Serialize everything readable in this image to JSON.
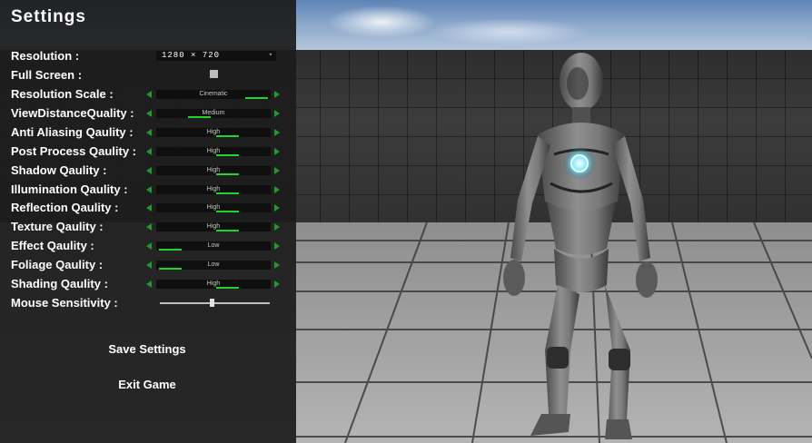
{
  "title": "Settings",
  "resolution": {
    "label": "Resolution :",
    "value": "1280  ×  720"
  },
  "fullscreen": {
    "label": "Full Screen :",
    "checked": false
  },
  "quality_rows": [
    {
      "label": "Resolution Scale :",
      "value": "Cinematic",
      "level": 1.0
    },
    {
      "label": "ViewDistanceQuality :",
      "value": "Medium",
      "level": 0.5
    },
    {
      "label": "Anti Aliasing Qaulity :",
      "value": "High",
      "level": 0.75
    },
    {
      "label": "Post Process Qaulity :",
      "value": "High",
      "level": 0.75
    },
    {
      "label": "Shadow Qaulity :",
      "value": "High",
      "level": 0.75
    },
    {
      "label": "Illumination Qaulity :",
      "value": "High",
      "level": 0.75
    },
    {
      "label": "Reflection Qaulity :",
      "value": "High",
      "level": 0.75
    },
    {
      "label": "Texture Qaulity :",
      "value": "High",
      "level": 0.75
    },
    {
      "label": "Effect Qaulity :",
      "value": "Low",
      "level": 0.25
    },
    {
      "label": "Foliage Qaulity :",
      "value": "Low",
      "level": 0.25
    },
    {
      "label": "Shading Qaulity :",
      "value": "High",
      "level": 0.75
    }
  ],
  "mouse_sensitivity": {
    "label": "Mouse Sensitivity :",
    "value": 0.47
  },
  "buttons": {
    "save": "Save Settings",
    "exit": "Exit Game"
  },
  "colors": {
    "accent": "#1fd22e",
    "arrow": "#1e9b2a",
    "panel": "#1c1c1c",
    "core_glow": "#7fe6ff"
  }
}
